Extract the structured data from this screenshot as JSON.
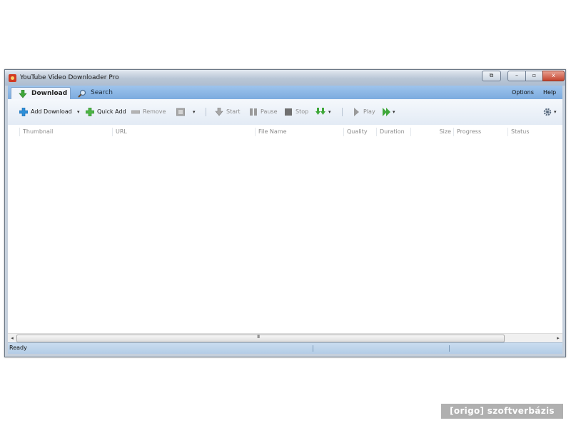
{
  "window": {
    "title": "YouTube Video Downloader Pro",
    "buttons": {
      "extra": "⧉",
      "minimize": "–",
      "maximize": "▫",
      "close": "x"
    }
  },
  "tabs": [
    {
      "label": "Download",
      "icon": "download-arrow-icon",
      "active": true
    },
    {
      "label": "Search",
      "icon": "magnifier-icon",
      "active": false
    }
  ],
  "menu": {
    "options": "Options",
    "help": "Help"
  },
  "toolbar": {
    "add_download": "Add Download",
    "quick_add": "Quick Add",
    "remove": "Remove",
    "start": "Start",
    "pause": "Pause",
    "stop": "Stop",
    "play": "Play",
    "dropdown_arrow": "▾"
  },
  "table": {
    "columns": [
      "Thumbnail",
      "URL",
      "File Name",
      "Quality",
      "Duration",
      "Size",
      "Progress",
      "Status"
    ],
    "rows": []
  },
  "scrollbar": {
    "left_arrow": "◂",
    "right_arrow": "▸",
    "grip": "III"
  },
  "statusbar": {
    "text": "Ready"
  },
  "watermark": "[origo] szoftverbázis",
  "colors": {
    "accent": "#7cabdf",
    "add_icon": "#2e8fd8",
    "download_icon": "#3fa83a",
    "close_button": "#c4442e"
  }
}
